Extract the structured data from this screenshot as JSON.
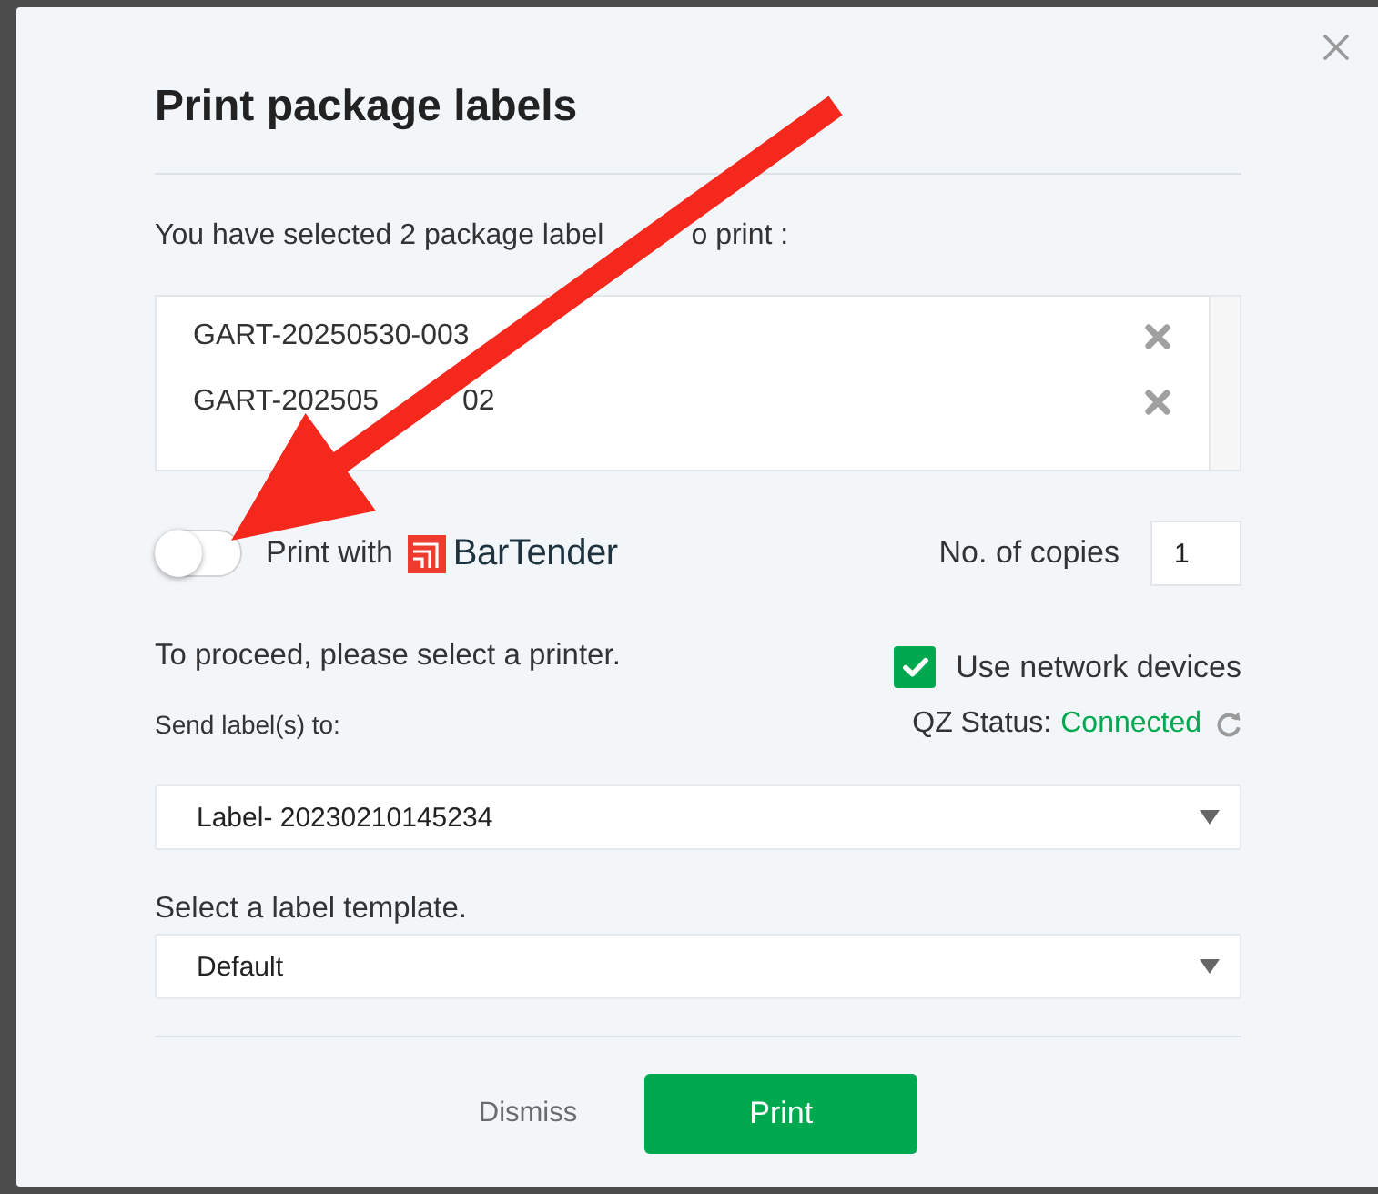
{
  "dialog": {
    "title": "Print package labels"
  },
  "selection_summary": {
    "visible_parts": [
      "You have selected 2 package label",
      "o print :"
    ]
  },
  "labels": [
    {
      "visible_parts": [
        "GART-20250530-003"
      ]
    },
    {
      "visible_parts": [
        "GART-202505",
        "02"
      ]
    }
  ],
  "bartender_toggle": {
    "label": "Print with",
    "brand": "BarTender",
    "on": false
  },
  "copies": {
    "label": "No. of copies",
    "value": "1"
  },
  "printer_prompt": "To proceed, please select a printer.",
  "network_devices": {
    "label": "Use network devices",
    "checked": true
  },
  "send_to_label": "Send label(s) to:",
  "qz_status": {
    "label": "QZ Status:",
    "value": "Connected"
  },
  "printer_select": {
    "value": "Label- 20230210145234"
  },
  "template_prompt": "Select a label template.",
  "template_select": {
    "value": "Default"
  },
  "buttons": [
    {
      "label": "Dismiss",
      "kind": "link"
    },
    {
      "label": "Print",
      "kind": "primary"
    }
  ],
  "annotations": [
    {
      "kind": "arrow"
    }
  ]
}
